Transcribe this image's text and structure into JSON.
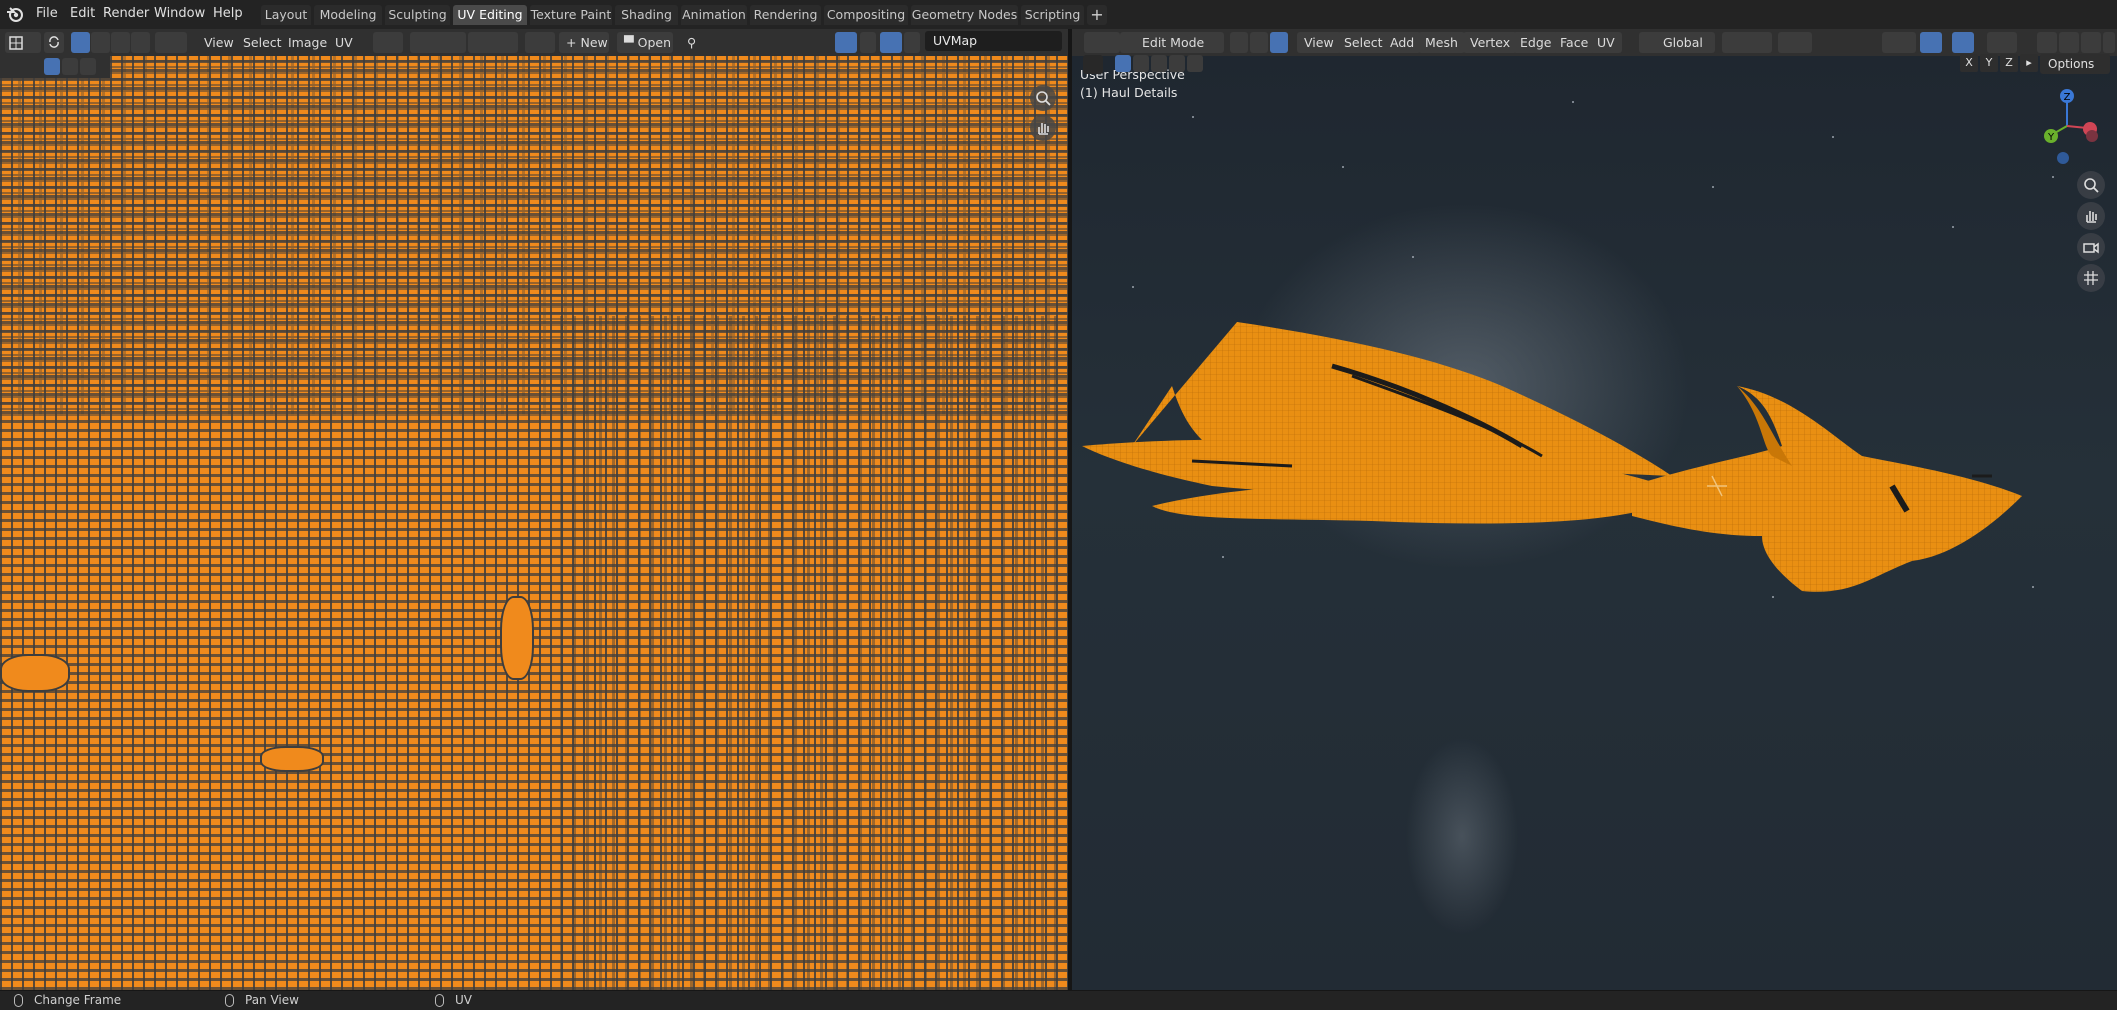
{
  "menu": {
    "items": [
      "File",
      "Edit",
      "Render",
      "Window",
      "Help"
    ],
    "logo": "blender-logo"
  },
  "workspaces": {
    "tabs": [
      "Layout",
      "Modeling",
      "Sculpting",
      "UV Editing",
      "Texture Paint",
      "Shading",
      "Animation",
      "Rendering",
      "Compositing",
      "Geometry Nodes",
      "Scripting"
    ],
    "active": "UV Editing",
    "add_label": "+"
  },
  "uv_editor": {
    "menus": [
      "View",
      "Select",
      "Image",
      "UV"
    ],
    "new_label": "New",
    "open_label": "Open",
    "uvmap_value": "UVMap",
    "icons": [
      "editor-type-icon",
      "sync-selection-icon",
      "vertex-select-icon",
      "edge-select-icon",
      "face-select-icon",
      "island-select-icon",
      "sticky-mode-icon",
      "pivot-icon",
      "snap-icon",
      "proportional-icon",
      "image-icon",
      "pin-icon",
      "overlay-icon",
      "gizmo-icon",
      "zoom-icon",
      "hand-icon"
    ]
  },
  "viewport": {
    "mode": "Edit Mode",
    "menus": [
      "View",
      "Select",
      "Add",
      "Mesh",
      "Vertex",
      "Edge",
      "Face",
      "UV"
    ],
    "transform_orientation": "Global",
    "overlay_line1": "User Perspective",
    "overlay_line2": "(1) Haul Details",
    "axis_labels": [
      "X",
      "Y",
      "Z"
    ],
    "options_label": "Options",
    "gizmo_axes": {
      "z": "Z",
      "y": "Y"
    },
    "icons": [
      "zoom-icon",
      "hand-icon",
      "camera-icon",
      "grid-icon"
    ]
  },
  "status": {
    "left": "Change Frame",
    "middle": "Pan View",
    "right": "UV"
  },
  "colors": {
    "accent": "#4772b3",
    "uv_orange": "#f08a1c",
    "mesh_orange": "#e98f12"
  }
}
